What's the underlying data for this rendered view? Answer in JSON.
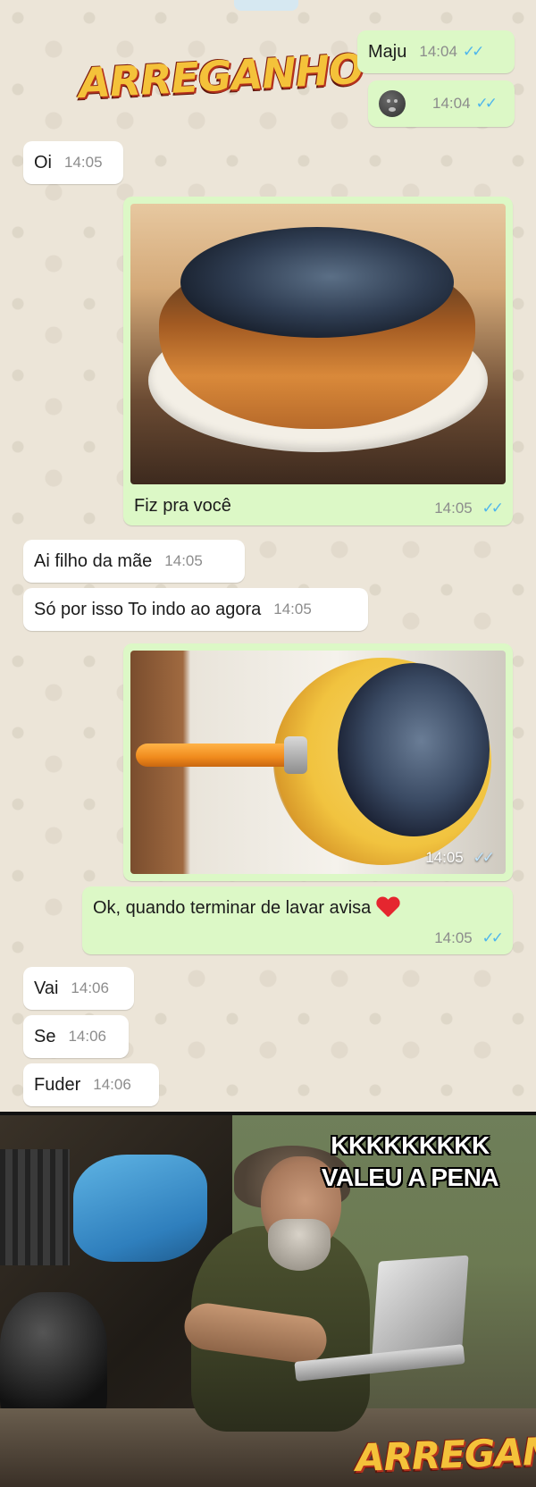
{
  "watermark": {
    "brand": "ARREGANHO"
  },
  "messages": {
    "out_maju": {
      "text": "Maju",
      "time": "14:04"
    },
    "out_emoji": {
      "icon": "neutral-face-emoji-icon",
      "time": "14:04"
    },
    "in_oi": {
      "text": "Oi",
      "time": "14:05"
    },
    "out_photo1": {
      "image": "burnt-pudding-photo",
      "caption": "Fiz pra você",
      "time": "14:05"
    },
    "in_ai": {
      "text": "Ai filho da mãe",
      "time": "14:05"
    },
    "in_so": {
      "text": "Só por isso To indo ao agora",
      "time": "14:05"
    },
    "out_photo2": {
      "image": "burnt-pan-photo",
      "time": "14:05"
    },
    "out_ok": {
      "text": "Ok, quando terminar de lavar avisa",
      "emoji": "red-heart-icon",
      "time": "14:05"
    },
    "in_vai": {
      "text": "Vai",
      "time": "14:06"
    },
    "in_se": {
      "text": "Se",
      "time": "14:06"
    },
    "in_fuder": {
      "text": "Fuder",
      "time": "14:06"
    }
  },
  "ticks": "✓✓",
  "meme": {
    "line1": "KKKKKKKKK",
    "line2": "VALEU A PENA",
    "image": "homeless-man-with-laptop-photo"
  },
  "colors": {
    "incoming_bubble": "#ffffff",
    "outgoing_bubble": "#dcf8c6",
    "read_ticks": "#4fb6ec",
    "chat_background": "#ece5d8"
  }
}
